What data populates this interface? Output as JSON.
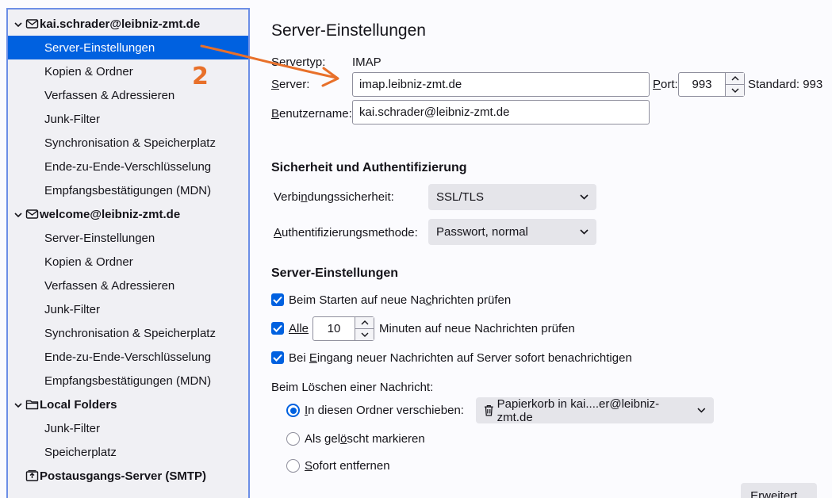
{
  "sidebar": {
    "rows": [
      {
        "type": "account",
        "label": "kai.schrader@leibniz-zmt.de",
        "icon": "mail-icon",
        "twisty": "chevron-down-icon"
      },
      {
        "type": "child",
        "label": "Server-Einstellungen",
        "selected": true
      },
      {
        "type": "child",
        "label": "Kopien & Ordner"
      },
      {
        "type": "child",
        "label": "Verfassen & Adressieren"
      },
      {
        "type": "child",
        "label": "Junk-Filter"
      },
      {
        "type": "child",
        "label": "Synchronisation & Speicherplatz"
      },
      {
        "type": "child",
        "label": "Ende-zu-Ende-Verschlüsselung"
      },
      {
        "type": "child",
        "label": "Empfangsbestätigungen (MDN)"
      },
      {
        "type": "account",
        "label": "welcome@leibniz-zmt.de",
        "icon": "mail-icon",
        "twisty": "chevron-down-icon"
      },
      {
        "type": "child",
        "label": "Server-Einstellungen"
      },
      {
        "type": "child",
        "label": "Kopien & Ordner"
      },
      {
        "type": "child",
        "label": "Verfassen & Adressieren"
      },
      {
        "type": "child",
        "label": "Junk-Filter"
      },
      {
        "type": "child",
        "label": "Synchronisation & Speicherplatz"
      },
      {
        "type": "child",
        "label": "Ende-zu-Ende-Verschlüsselung"
      },
      {
        "type": "child",
        "label": "Empfangsbestätigungen (MDN)"
      },
      {
        "type": "account",
        "label": "Local Folders",
        "icon": "folder-icon",
        "twisty": "chevron-down-icon"
      },
      {
        "type": "child",
        "label": "Junk-Filter"
      },
      {
        "type": "child",
        "label": "Speicherplatz"
      },
      {
        "type": "account",
        "label": "Postausgangs-Server (SMTP)",
        "icon": "outbox-icon",
        "twisty": ""
      }
    ]
  },
  "main": {
    "title": "Server-Einstellungen",
    "server_type_label": "Servertyp:",
    "server_type_value": "IMAP",
    "server_label": "Server:",
    "server_value": "imap.leibniz-zmt.de",
    "port_label": "Port:",
    "port_value": "993",
    "port_default": "Standard: 993",
    "username_label": "Benutzername:",
    "username_value": "kai.schrader@leibniz-zmt.de",
    "security_heading": "Sicherheit und Authentifizierung",
    "conn_security_label": "Verbindungssicherheit:",
    "conn_security_value": "SSL/TLS",
    "auth_method_label": "Authentifizierungsmethode:",
    "auth_method_value": "Passwort, normal",
    "server_settings_heading": "Server-Einstellungen",
    "check_startup_label": "Beim Starten auf neue Nachrichten prüfen",
    "check_every_label": "Alle",
    "check_every_value": "10",
    "check_every_suffix": "Minuten auf neue Nachrichten prüfen",
    "notify_label": "Bei Eingang neuer Nachrichten auf Server sofort benachrichtigen",
    "delete_heading": "Beim Löschen einer Nachricht:",
    "move_label": "In diesen Ordner verschieben:",
    "move_folder_value": "Papierkorb in kai....er@leibniz-zmt.de",
    "mark_deleted_label": "Als gelöscht markieren",
    "remove_now_label": "Sofort entfernen",
    "advanced_button": "Erweitert..."
  },
  "annotation": {
    "number": "2",
    "color": "#e8702a"
  },
  "colors": {
    "accent": "#0061e0",
    "sidebar_bg": "#f0f0f4",
    "sidebar_border": "#6c8ee6"
  }
}
